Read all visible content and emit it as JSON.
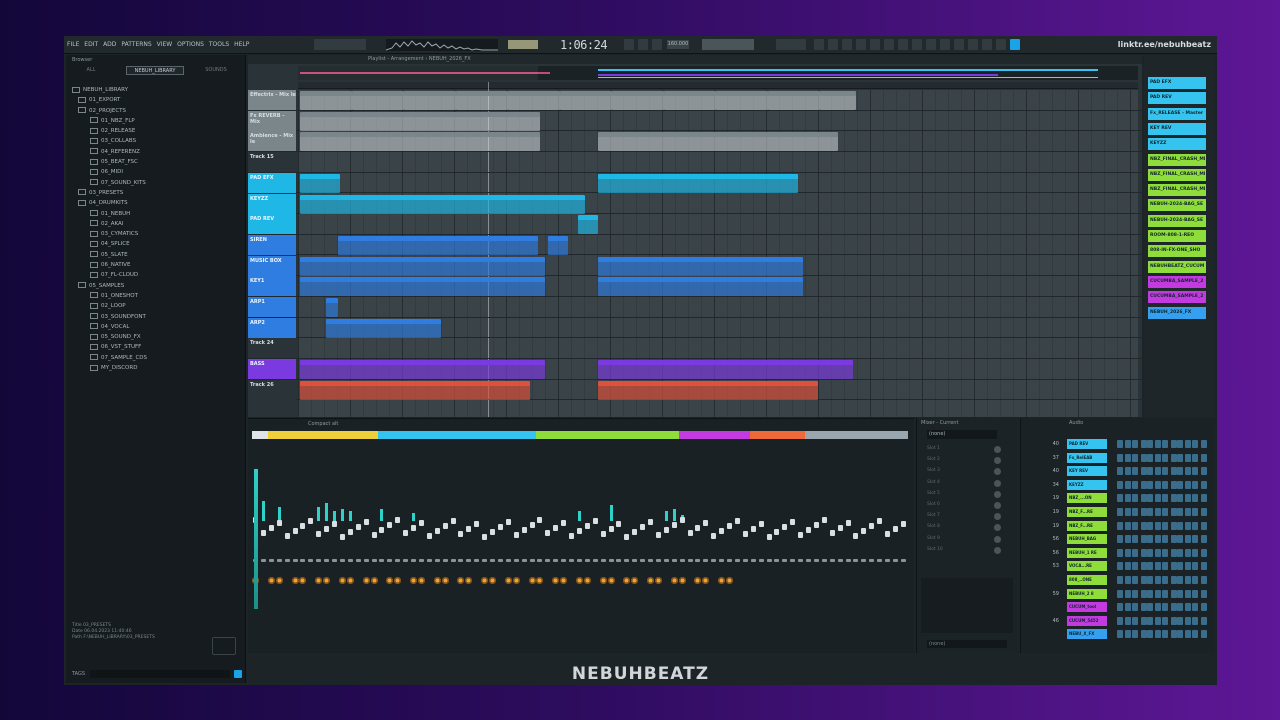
{
  "menu": [
    "FILE",
    "EDIT",
    "ADD",
    "PATTERNS",
    "VIEW",
    "OPTIONS",
    "TOOLS",
    "HELP"
  ],
  "time": "1:06:24",
  "bpm": "160.000",
  "link": "linktr.ee/nebuhbeatz",
  "browser": {
    "title": "Browser",
    "tabs": [
      "ALL",
      "NEBUH_LIBRARY",
      "SOUNDS"
    ],
    "tree": [
      {
        "label": "NEBUH_LIBRARY",
        "lvl": 0
      },
      {
        "label": "01_EXPORT",
        "lvl": 1
      },
      {
        "label": "02_PROJECTS",
        "lvl": 1
      },
      {
        "label": "01_NBZ_FLP",
        "lvl": 2
      },
      {
        "label": "02_RELEASE",
        "lvl": 2
      },
      {
        "label": "03_COLLABS",
        "lvl": 2
      },
      {
        "label": "04_REFERENZ",
        "lvl": 2
      },
      {
        "label": "05_BEAT_FSC",
        "lvl": 2
      },
      {
        "label": "06_MIDI",
        "lvl": 2
      },
      {
        "label": "07_SOUND_KITS",
        "lvl": 2
      },
      {
        "label": "03_PRESETS",
        "lvl": 1
      },
      {
        "label": "04_DRUMKITS",
        "lvl": 1
      },
      {
        "label": "01_NEBUH",
        "lvl": 2
      },
      {
        "label": "02_AKAI",
        "lvl": 2
      },
      {
        "label": "03_CYMATICS",
        "lvl": 2
      },
      {
        "label": "04_SPLICE",
        "lvl": 2
      },
      {
        "label": "05_SLATE",
        "lvl": 2
      },
      {
        "label": "06_NATIVE",
        "lvl": 2
      },
      {
        "label": "07_FL-CLOUD",
        "lvl": 2
      },
      {
        "label": "05_SAMPLES",
        "lvl": 1
      },
      {
        "label": "01_ONESHOT",
        "lvl": 2
      },
      {
        "label": "02_LOOP",
        "lvl": 2
      },
      {
        "label": "03_SOUNDFONT",
        "lvl": 2
      },
      {
        "label": "04_VOCAL",
        "lvl": 2
      },
      {
        "label": "05_SOUND_FX",
        "lvl": 2
      },
      {
        "label": "06_VST_STUFF",
        "lvl": 2
      },
      {
        "label": "07_SAMPLE_CDS",
        "lvl": 2
      },
      {
        "label": "MY_DISCORD",
        "lvl": 2
      }
    ],
    "info_title": "Title    03_PRESETS",
    "info_date": "Date     06.04.2023 11:40:46",
    "info_path": "Path     F:\\NEBUH_LIBRARY\\03_PRESETS",
    "tags": "TAGS"
  },
  "playlist": {
    "title": "Playlist - Arrangement › NEBUH_2026_FX",
    "tracks": [
      {
        "name": "Effectrix - Mix le",
        "color": "#7b868b"
      },
      {
        "name": "Fx REVERB - Mix",
        "color": "#7b868b"
      },
      {
        "name": "Ambience - Mix le",
        "color": "#7b868b"
      },
      {
        "name": "Track 15",
        "color": "#2a3337"
      },
      {
        "name": "PAD EFX",
        "color": "#1fb8e6"
      },
      {
        "name": "KEYZZ",
        "color": "#1fb8e6"
      },
      {
        "name": "PAD REV",
        "color": "#1fb8e6"
      },
      {
        "name": "SIREN",
        "color": "#2f7de0"
      },
      {
        "name": "MUSIC BOX",
        "color": "#2f7de0"
      },
      {
        "name": "KEY1",
        "color": "#2f7de0"
      },
      {
        "name": "ARP1",
        "color": "#2f7de0"
      },
      {
        "name": "ARP2",
        "color": "#2f7de0"
      },
      {
        "name": "Track 24",
        "color": "#2a3337"
      },
      {
        "name": "BASS",
        "color": "#7b3ae0"
      },
      {
        "name": "Track 26",
        "color": "#2a3337"
      }
    ]
  },
  "right_list": [
    {
      "label": "PAD EFX",
      "color": "#35c4ef"
    },
    {
      "label": "PAD REV",
      "color": "#35c4ef"
    },
    {
      "label": "Fx_RELEASE - Master",
      "color": "#35c4ef"
    },
    {
      "label": "KEY REV",
      "color": "#35c4ef"
    },
    {
      "label": "KEYZZ",
      "color": "#35c4ef"
    },
    {
      "label": "NBZ_FINAL_CRASH_MI",
      "color": "#8fdd3a"
    },
    {
      "label": "NBZ_FINAL_CRASH_MI",
      "color": "#8fdd3a"
    },
    {
      "label": "NBZ_FINAL_CRASH_MI",
      "color": "#8fdd3a"
    },
    {
      "label": "NEBUH-2024-BAG_SE",
      "color": "#8fdd3a"
    },
    {
      "label": "NEBUH-2024-BAG_SE",
      "color": "#8fdd3a"
    },
    {
      "label": "ROOM-808-1-REO",
      "color": "#8fdd3a"
    },
    {
      "label": "808-IN-FX-ONE_SHO",
      "color": "#8fdd3a"
    },
    {
      "label": "NEBUHBEATZ_CUCUM",
      "color": "#8fdd3a"
    },
    {
      "label": "CUCUMBA_SAMPLE_2",
      "color": "#c33ae0"
    },
    {
      "label": "CUCUMBA_SAMPLE_2",
      "color": "#c33ae0"
    },
    {
      "label": "NEBUH_2026_FX",
      "color": "#35a0ef"
    }
  ],
  "mixer": {
    "title": "Compact alt",
    "insert_title": "Mixer - Current",
    "insert_none": "(none)"
  },
  "slots": [
    "Slot 1",
    "Slot 2",
    "Slot 3",
    "Slot 4",
    "Slot 5",
    "Slot 6",
    "Slot 7",
    "Slot 8",
    "Slot 9",
    "Slot 10"
  ],
  "channel_rack": {
    "title": "Audio",
    "rows": [
      {
        "num": "40",
        "name": "PAD REV",
        "color": "#35c4ef"
      },
      {
        "num": "37",
        "name": "Fx_RelEAB",
        "color": "#35c4ef"
      },
      {
        "num": "40",
        "name": "KEY REV",
        "color": "#35c4ef"
      },
      {
        "num": "34",
        "name": "KEYZZ",
        "color": "#35c4ef"
      },
      {
        "num": "19",
        "name": "NBZ_...ON",
        "color": "#8fdd3a"
      },
      {
        "num": "19",
        "name": "NBZ_F...RE",
        "color": "#8fdd3a"
      },
      {
        "num": "19",
        "name": "NBZ_F...RE",
        "color": "#8fdd3a"
      },
      {
        "num": "56",
        "name": "NEBUH_BAG",
        "color": "#8fdd3a"
      },
      {
        "num": "56",
        "name": "NEBUH_1 RE",
        "color": "#8fdd3a"
      },
      {
        "num": "53",
        "name": "VOCA...RE",
        "color": "#8fdd3a"
      },
      {
        "num": "",
        "name": "808_..ONE",
        "color": "#8fdd3a"
      },
      {
        "num": "59",
        "name": "NEBUH_2 8",
        "color": "#8fdd3a"
      },
      {
        "num": "",
        "name": "CUCUM_tool",
        "color": "#c33ae0"
      },
      {
        "num": "46",
        "name": "CUCUM_5452",
        "color": "#c33ae0"
      },
      {
        "num": "",
        "name": "NEBU_X_FX",
        "color": "#35a0ef"
      }
    ]
  },
  "footer": "NEBUHBEATZ",
  "accent_colors": {
    "teal": "#2fd1c8",
    "orange": "#f0a23a",
    "cyan": "#1fb8e6",
    "blue": "#2f7de0",
    "purple": "#7b3ae0",
    "green": "#8fdd3a"
  }
}
